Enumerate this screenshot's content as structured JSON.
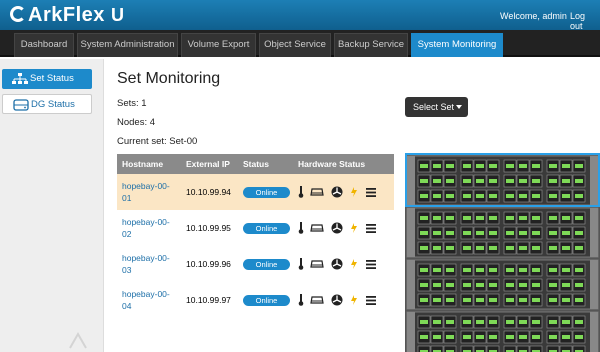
{
  "header": {
    "logo_text": "ArkFlex",
    "logo_suffix": "U",
    "welcome": "Welcome, admin",
    "logout": "Log out"
  },
  "nav": {
    "tabs": [
      {
        "label": "Dashboard"
      },
      {
        "label": "System Administration"
      },
      {
        "label": "Volume Export"
      },
      {
        "label": "Object Service"
      },
      {
        "label": "Backup Service"
      },
      {
        "label": "System Monitoring",
        "active": true
      }
    ]
  },
  "sidebar": {
    "items": [
      {
        "label": "Set Status",
        "icon": "network-icon",
        "active": true
      },
      {
        "label": "DG Status",
        "icon": "disk-icon",
        "active": false
      }
    ]
  },
  "main": {
    "title": "Set Monitoring",
    "sets": "Sets: 1",
    "nodes": "Nodes: 4",
    "current_set": "Current set: Set-00",
    "select_button": "Select Set"
  },
  "table": {
    "headers": [
      "Hostname",
      "External IP",
      "Status",
      "Hardware Status"
    ],
    "rows": [
      {
        "host1": "hopebay-00-",
        "host2": "01",
        "ip": "10.10.99.94",
        "status": "Online"
      },
      {
        "host1": "hopebay-00-",
        "host2": "02",
        "ip": "10.10.99.95",
        "status": "Online"
      },
      {
        "host1": "hopebay-00-",
        "host2": "03",
        "ip": "10.10.99.96",
        "status": "Online"
      },
      {
        "host1": "hopebay-00-",
        "host2": "04",
        "ip": "10.10.99.97",
        "status": "Online"
      }
    ]
  },
  "colors": {
    "accent": "#1d8acb",
    "highlight_row": "#fbe6c5",
    "nav_bg": "#222222",
    "disk_green": "#7ed957"
  }
}
